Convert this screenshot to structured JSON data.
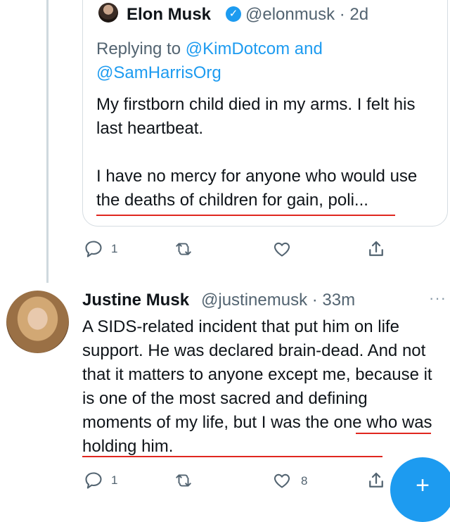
{
  "quoted": {
    "name": "Elon Musk",
    "handle_time": "@elonmusk · 2d",
    "replying_prefix": "Replying to ",
    "mention1": "@KimDotcom",
    "and": " and",
    "mention2": "@SamHarrisOrg",
    "text": "My firstborn child died in my arms. I felt his last heartbeat.\n\nI have no mercy for anyone who would use the deaths of children for gain, poli..."
  },
  "actions1": {
    "reply_count": "1",
    "retweet_count": "",
    "like_count": ""
  },
  "reply": {
    "name": "Justine Musk",
    "handle_time": "@justinemusk · 33m",
    "more": "···",
    "text": "A SIDS-related incident that put him on life support. He was declared brain-dead. And not that it matters to anyone except me, because it is one of the most sacred and defining moments of my life, but I was the one who was holding him."
  },
  "actions2": {
    "reply_count": "1",
    "like_count": "8"
  },
  "compose_fab": {
    "label": "+"
  },
  "colors": {
    "accent": "#1d9bf0",
    "muted": "#536471",
    "annotation_underline": "#e0271f"
  },
  "icons": [
    "verified-badge-icon",
    "reply-icon",
    "retweet-icon",
    "like-icon",
    "share-icon",
    "more-icon",
    "compose-plus-icon"
  ]
}
